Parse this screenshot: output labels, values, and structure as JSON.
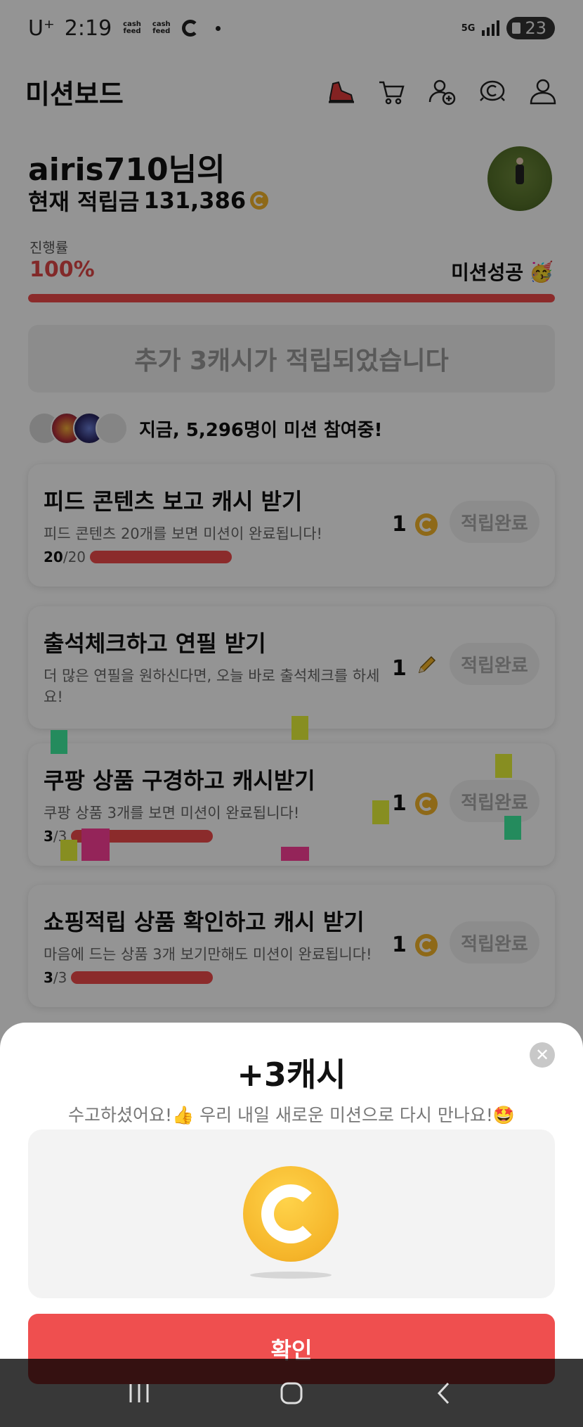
{
  "status_bar": {
    "carrier": "U⁺",
    "time": "2:19",
    "app_badges": [
      "cash feed",
      "cash feed"
    ],
    "network": "5G",
    "battery": "23"
  },
  "header": {
    "title": "미션보드",
    "icons": [
      "shoe-icon",
      "cart-icon",
      "add-friend-icon",
      "cash-coin-icon",
      "profile-icon"
    ]
  },
  "user": {
    "name": "airis710님의",
    "balance_label": "현재 적립금",
    "balance": "131,386"
  },
  "progress": {
    "label": "진행률",
    "value": "100%",
    "fraction": 1.0,
    "status": "미션성공",
    "status_emoji": "🥳"
  },
  "bonus": {
    "text": "추가 3캐시가 적립되었습니다"
  },
  "participants": {
    "prefix": "지금, ",
    "count": "5,296명",
    "suffix": "이 미션 참여중!"
  },
  "missions": [
    {
      "title": "피드 콘텐츠 보고 캐시 받기",
      "desc": "피드 콘텐츠 20개를 보면 미션이 완료됩니다!",
      "progress_done": "20",
      "progress_total": "/20",
      "reward_amount": "1",
      "reward_icon": "coin-icon",
      "button": "적립완료"
    },
    {
      "title": "출석체크하고 연필 받기",
      "desc": "더 많은 연필을 원하신다면, 오늘 바로 출석체크를 하세요!",
      "reward_amount": "1",
      "reward_icon": "pencil-icon",
      "button": "적립완료"
    },
    {
      "title": "쿠팡 상품 구경하고 캐시받기",
      "desc": "쿠팡 상품 3개를 보면 미션이 완료됩니다!",
      "progress_done": "3",
      "progress_total": "/3",
      "reward_amount": "1",
      "reward_icon": "coin-icon",
      "button": "적립완료"
    },
    {
      "title": "쇼핑적립 상품 확인하고 캐시 받기",
      "desc": "마음에 드는 상품 3개 보기만해도 미션이 완료됩니다!",
      "progress_done": "3",
      "progress_total": "/3",
      "reward_amount": "1",
      "reward_icon": "coin-icon",
      "button": "적립완료"
    }
  ],
  "sheet": {
    "title": "+3캐시",
    "message": "수고하셨어요!👍 우리 내일 새로운 미션으로 다시 만나요!🤩",
    "confirm": "확인"
  },
  "nav": [
    "recent-apps-icon",
    "home-icon",
    "back-icon"
  ],
  "colors": {
    "accent": "#ef4a4a",
    "coin": "#f5b52a",
    "progress_text": "#e04848"
  }
}
